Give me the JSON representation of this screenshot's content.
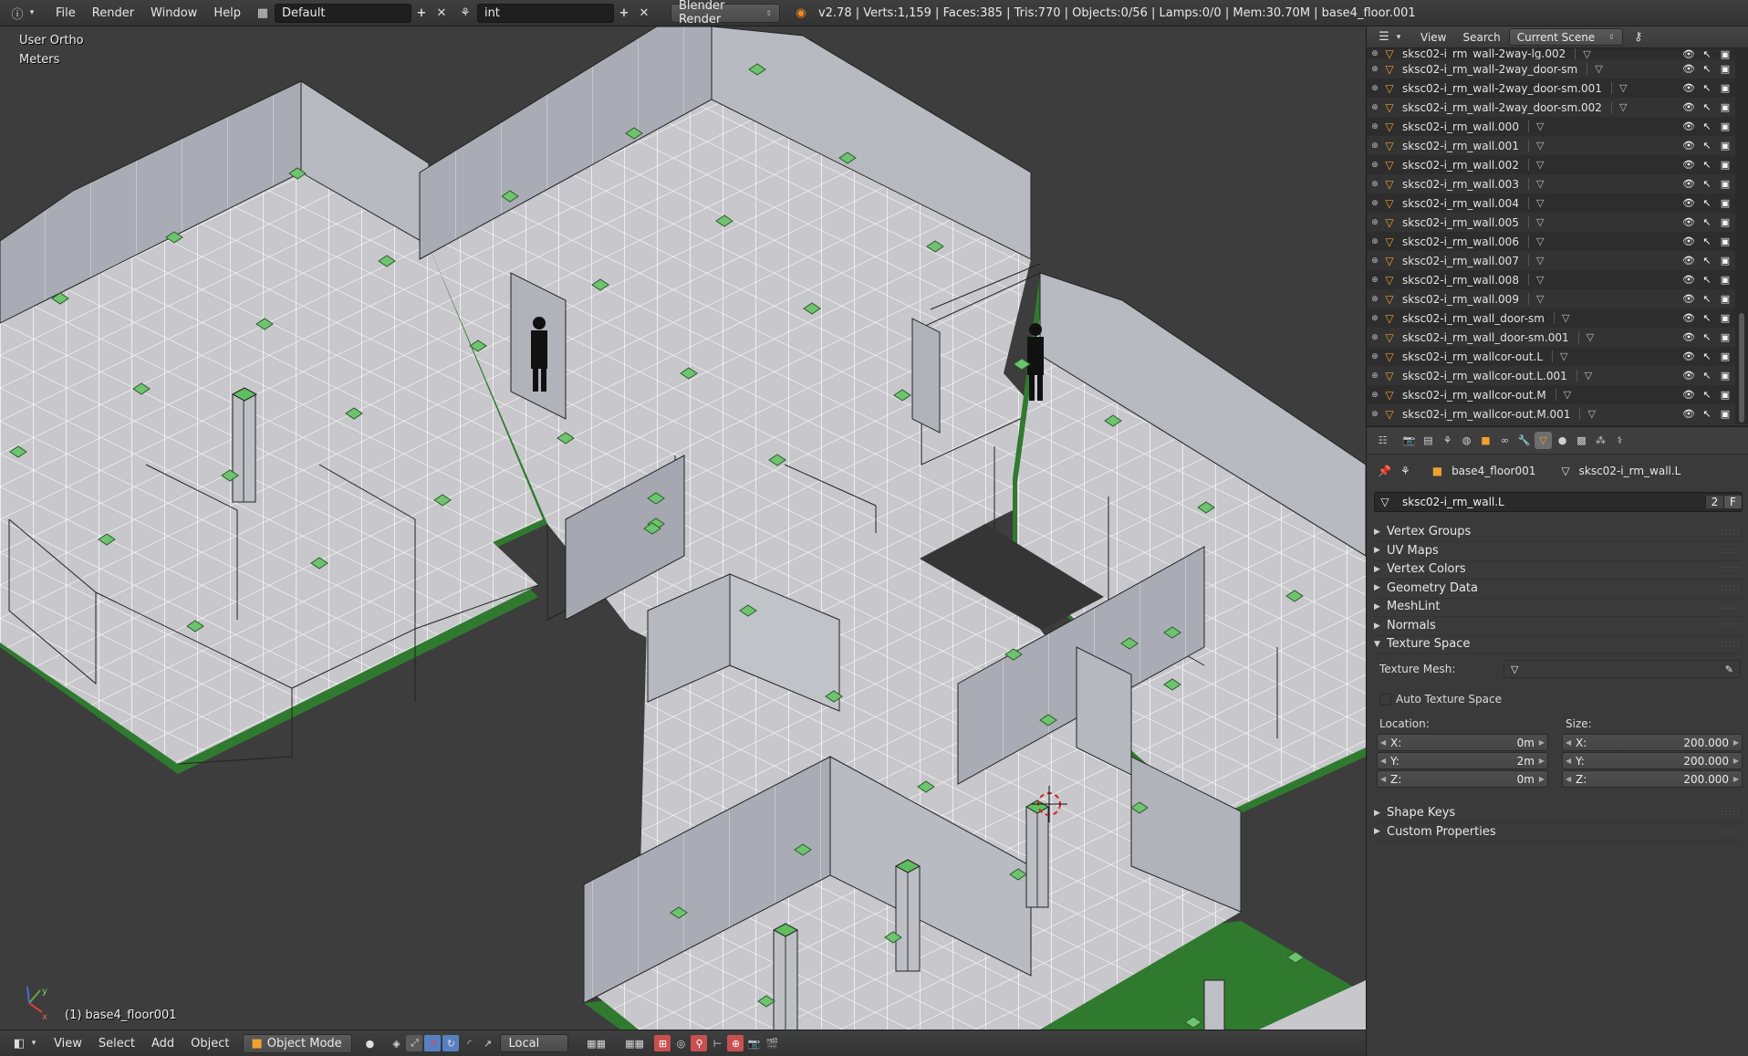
{
  "header": {
    "menus": [
      "File",
      "Render",
      "Window",
      "Help"
    ],
    "screen_layout": "Default",
    "scene_name": "int",
    "render_engine": "Blender Render",
    "stats": "v2.78 | Verts:1,159 | Faces:385 | Tris:770 | Objects:0/56 | Lamps:0/0 | Mem:30.70M | base4_floor.001"
  },
  "viewport": {
    "view_name": "User Ortho",
    "units": "Meters",
    "active_object_label": "(1) base4_floor001",
    "colors": {
      "floor": "#c8c8cc",
      "wall": "#a8abb3",
      "edge_green": "#2f7a2f",
      "marker": "#6ec46e",
      "background": "#3d3d3d"
    }
  },
  "bottombar": {
    "menus": [
      "View",
      "Select",
      "Add",
      "Object"
    ],
    "mode": "Object Mode",
    "pivot": "Local"
  },
  "outliner": {
    "menus": [
      "View",
      "Search"
    ],
    "scope": "Current Scene",
    "items": [
      {
        "name": "sksc02-i_rm_wall-2way-lg.002",
        "partial": true
      },
      {
        "name": "sksc02-i_rm_wall-2way_door-sm"
      },
      {
        "name": "sksc02-i_rm_wall-2way_door-sm.001"
      },
      {
        "name": "sksc02-i_rm_wall-2way_door-sm.002"
      },
      {
        "name": "sksc02-i_rm_wall.000"
      },
      {
        "name": "sksc02-i_rm_wall.001"
      },
      {
        "name": "sksc02-i_rm_wall.002"
      },
      {
        "name": "sksc02-i_rm_wall.003"
      },
      {
        "name": "sksc02-i_rm_wall.004"
      },
      {
        "name": "sksc02-i_rm_wall.005"
      },
      {
        "name": "sksc02-i_rm_wall.006"
      },
      {
        "name": "sksc02-i_rm_wall.007"
      },
      {
        "name": "sksc02-i_rm_wall.008"
      },
      {
        "name": "sksc02-i_rm_wall.009"
      },
      {
        "name": "sksc02-i_rm_wall_door-sm"
      },
      {
        "name": "sksc02-i_rm_wall_door-sm.001"
      },
      {
        "name": "sksc02-i_rm_wallcor-out.L"
      },
      {
        "name": "sksc02-i_rm_wallcor-out.L.001"
      },
      {
        "name": "sksc02-i_rm_wallcor-out.M"
      },
      {
        "name": "sksc02-i_rm_wallcor-out.M.001"
      }
    ]
  },
  "properties": {
    "context_object": "base4_floor001",
    "context_mesh": "sksc02-i_rm_wall.L",
    "mesh_name": "sksc02-i_rm_wall.L",
    "users": "2",
    "fake_user": "F",
    "panels_collapsed_top": [
      "Vertex Groups",
      "UV Maps",
      "Vertex Colors",
      "Geometry Data",
      "MeshLint",
      "Normals"
    ],
    "texture_space": {
      "title": "Texture Space",
      "texture_mesh_label": "Texture Mesh:",
      "auto_label": "Auto Texture Space",
      "auto_checked": false,
      "location_label": "Location:",
      "size_label": "Size:",
      "location": [
        {
          "axis": "X:",
          "value": "0m"
        },
        {
          "axis": "Y:",
          "value": "2m"
        },
        {
          "axis": "Z:",
          "value": "0m"
        }
      ],
      "size": [
        {
          "axis": "X:",
          "value": "200.000"
        },
        {
          "axis": "Y:",
          "value": "200.000"
        },
        {
          "axis": "Z:",
          "value": "200.000"
        }
      ]
    },
    "panels_collapsed_bottom": [
      "Shape Keys",
      "Custom Properties"
    ]
  }
}
